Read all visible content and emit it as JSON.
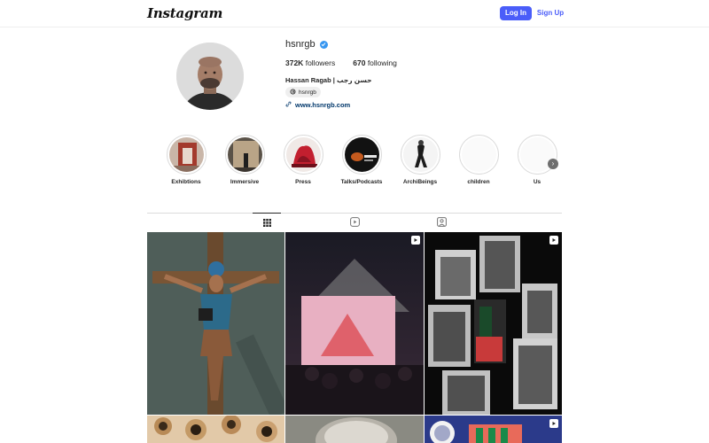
{
  "nav": {
    "logo": "Instagram",
    "login_label": "Log In",
    "signup_label": "Sign Up"
  },
  "profile": {
    "username": "hsnrgb",
    "verified": true,
    "followers_count": "372K",
    "followers_label": "followers",
    "following_count": "670",
    "following_label": "following",
    "full_name": "Hassan Ragab | حسن رجب",
    "threads_handle": "hsnrgb",
    "website": "www.hsnrgb.com"
  },
  "highlights": [
    {
      "label": "Exhibtions",
      "icon": "exhibition-room-thumb"
    },
    {
      "label": "Immersive",
      "icon": "immersive-room-thumb"
    },
    {
      "label": "Press",
      "icon": "press-red-building-thumb"
    },
    {
      "label": "Talks/Podcasts",
      "icon": "talks-dark-thumb"
    },
    {
      "label": "ArchiBeings",
      "icon": "archibeings-figure-thumb"
    },
    {
      "label": "children",
      "icon": "blank-thumb"
    },
    {
      "label": "Us",
      "icon": "blank-thumb"
    }
  ],
  "tabs": [
    {
      "name": "posts",
      "icon": "grid-icon",
      "active": true
    },
    {
      "name": "reels",
      "icon": "reels-icon",
      "active": false
    },
    {
      "name": "tagged",
      "icon": "tagged-icon",
      "active": false
    }
  ],
  "posts": [
    {
      "type": "image",
      "subject": "crucifixion-figure"
    },
    {
      "type": "reel",
      "subject": "pyramid-projection-concert"
    },
    {
      "type": "reel",
      "subject": "bw-building-collage"
    },
    {
      "type": "image",
      "subject": "organic-sculpture"
    },
    {
      "type": "image",
      "subject": "portrait-closeup"
    },
    {
      "type": "reel",
      "subject": "blue-poster"
    }
  ],
  "colors": {
    "accent": "#4a5df9",
    "verified": "#3897f0",
    "link": "#00376b"
  }
}
